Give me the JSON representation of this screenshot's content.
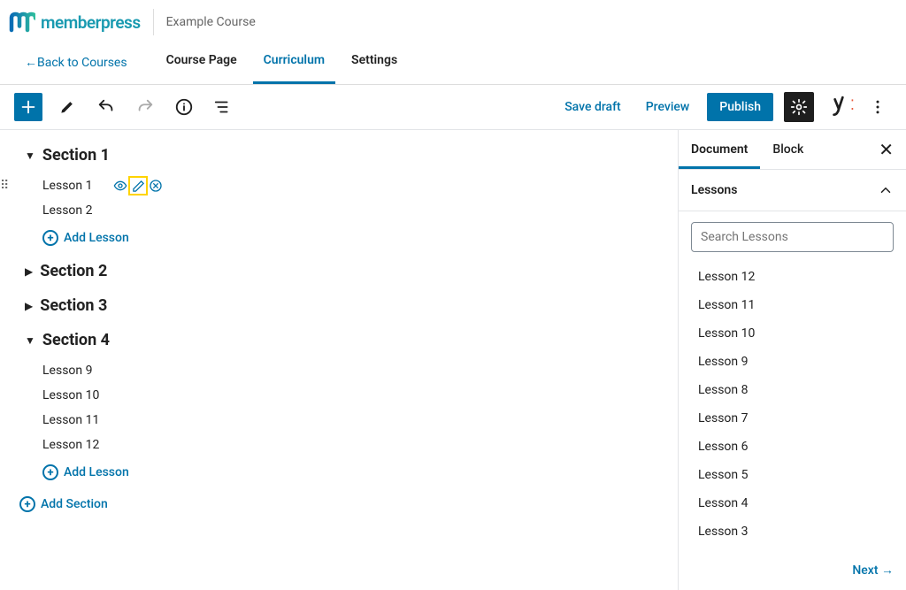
{
  "brand": {
    "name": "memberpress"
  },
  "breadcrumb": {
    "title": "Example Course",
    "back": "←Back to Courses"
  },
  "tabs": [
    {
      "label": "Course Page",
      "active": false
    },
    {
      "label": "Curriculum",
      "active": true
    },
    {
      "label": "Settings",
      "active": false
    }
  ],
  "toolbar": {
    "save_draft": "Save draft",
    "preview": "Preview",
    "publish": "Publish"
  },
  "sections": [
    {
      "title": "Section 1",
      "expanded": true,
      "lessons": [
        "Lesson 1",
        "Lesson 2"
      ]
    },
    {
      "title": "Section 2",
      "expanded": false,
      "lessons": []
    },
    {
      "title": "Section 3",
      "expanded": false,
      "lessons": []
    },
    {
      "title": "Section 4",
      "expanded": true,
      "lessons": [
        "Lesson 9",
        "Lesson 10",
        "Lesson 11",
        "Lesson 12"
      ]
    }
  ],
  "add_lesson_label": "Add Lesson",
  "add_section_label": "Add Section",
  "sidebar": {
    "tabs": [
      {
        "label": "Document",
        "active": true
      },
      {
        "label": "Block",
        "active": false
      }
    ],
    "panel_title": "Lessons",
    "search_placeholder": "Search Lessons",
    "results": [
      "Lesson 12",
      "Lesson 11",
      "Lesson 10",
      "Lesson 9",
      "Lesson 8",
      "Lesson 7",
      "Lesson 6",
      "Lesson 5",
      "Lesson 4",
      "Lesson 3"
    ],
    "next": "Next →"
  }
}
